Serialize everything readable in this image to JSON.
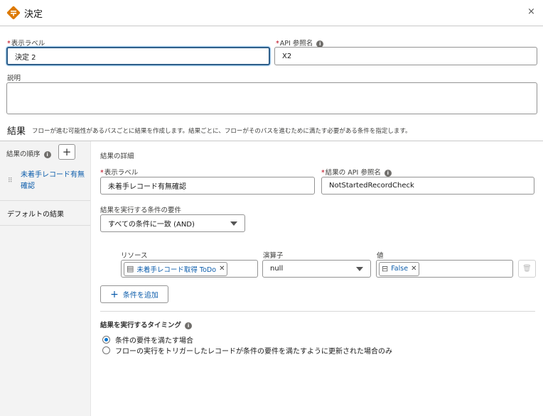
{
  "header": {
    "title": "決定",
    "close_label": "×"
  },
  "form": {
    "label_label": "表示ラベル",
    "label_value": "決定 2",
    "api_label": "API 参照名",
    "api_value": "X2",
    "description_label": "説明",
    "description_value": ""
  },
  "outcomes": {
    "heading": "結果",
    "description": "フローが進む可能性があるパスごとに結果を作成します。結果ごとに、フローがそのパスを進むために満たす必要がある条件を指定します。",
    "order_label": "結果の順序",
    "add_label": "+",
    "items": [
      {
        "label": "未着手レコード有無確認"
      }
    ],
    "default_label": "デフォルトの結果"
  },
  "detail": {
    "heading": "結果の詳細",
    "label_label": "表示ラベル",
    "label_value": "未着手レコード有無確認",
    "api_label": "結果の API 参照名",
    "api_value": "NotStartedRecordCheck",
    "requirement_label": "結果を実行する条件の要件",
    "requirement_value": "すべての条件に一致 (AND)",
    "condition": {
      "resource_label": "リソース",
      "resource_value": "未着手レコード取得 ToDo",
      "operator_label": "演算子",
      "operator_value": "null",
      "value_label": "値",
      "value_value": "False"
    },
    "add_condition_label": "条件を追加",
    "timing_heading": "結果を実行するタイミング",
    "timing_options": [
      {
        "label": "条件の要件を満たす場合",
        "selected": true
      },
      {
        "label": "フローの実行をトリガーしたレコードが条件の要件を満たすように更新された場合のみ",
        "selected": false
      }
    ]
  },
  "colors": {
    "accent": "#0176d3",
    "logo": "#dd7a01"
  }
}
